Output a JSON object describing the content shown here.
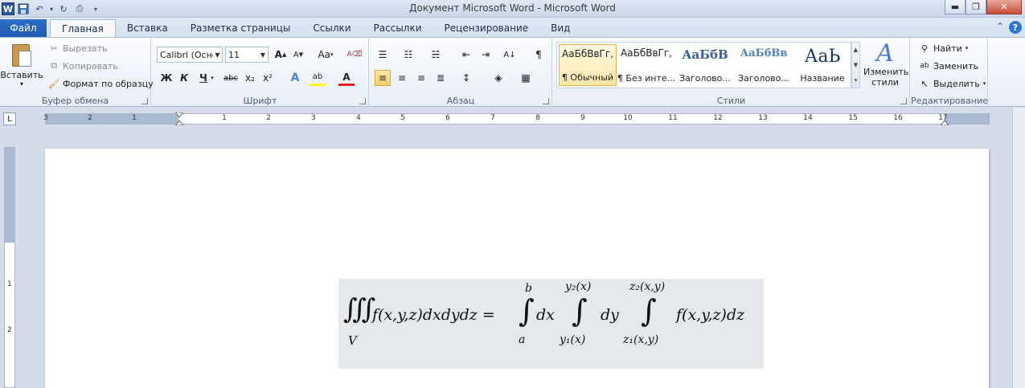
{
  "window": {
    "title": "Документ Microsoft Word  -  Microsoft Word"
  },
  "quick_access": {
    "app_logo": "W",
    "undo_arrow": "▾",
    "customize": "▾"
  },
  "tabs": {
    "file": "Файл",
    "items": [
      "Главная",
      "Вставка",
      "Разметка страницы",
      "Ссылки",
      "Рассылки",
      "Рецензирование",
      "Вид"
    ],
    "active_index": 0
  },
  "clipboard": {
    "paste": "Вставить",
    "cut": "Вырезать",
    "copy": "Копировать",
    "format_painter": "Формат по образцу",
    "group": "Буфер обмена"
  },
  "font": {
    "name": "Calibri (Осно",
    "size": "11",
    "grow": "A",
    "shrink": "A",
    "case": "Aa",
    "bold": "Ж",
    "italic": "К",
    "underline": "Ч",
    "strike": "abc",
    "subscript": "x₂",
    "superscript": "x²",
    "effects": "A",
    "highlight": "ab",
    "color": "A",
    "group": "Шрифт"
  },
  "paragraph": {
    "group": "Абзац",
    "pilcrow": "¶"
  },
  "styles": {
    "items": [
      {
        "sample": "АаБбВвГг,",
        "name": "¶ Обычный"
      },
      {
        "sample": "АаБбВвГг,",
        "name": "¶ Без инте..."
      },
      {
        "sample": "АаБбВ",
        "name": "Заголово..."
      },
      {
        "sample": "АаБбВв",
        "name": "Заголово..."
      },
      {
        "sample": "АаЬ",
        "name": "Название"
      }
    ],
    "change": "Изменить стили",
    "group": "Стили"
  },
  "editing": {
    "find": "Найти",
    "replace": "Заменить",
    "select": "Выделить",
    "group": "Редактирование"
  },
  "ruler": {
    "tab_selector": "L",
    "numbers": [
      "3",
      "2",
      "1",
      "1",
      "2",
      "3",
      "4",
      "5",
      "6",
      "7",
      "8",
      "9",
      "10",
      "11",
      "12",
      "13",
      "14",
      "15",
      "16",
      "17"
    ],
    "vertical_numbers": [
      "1",
      "2"
    ]
  },
  "equation": {
    "triple_integral": "∭",
    "region": "V",
    "lhs": "f(x,y,z)dxdydz =",
    "int_symbol": "∫",
    "outer_upper": "b",
    "outer_lower": "a",
    "outer_diff": "dx",
    "middle_upper": "y₂(x)",
    "middle_lower": "y₁(x)",
    "middle_diff": "dy",
    "inner_upper": "z₂(x,y)",
    "inner_lower": "z₁(x,y)",
    "integrand": "f(x,y,z)dz"
  }
}
